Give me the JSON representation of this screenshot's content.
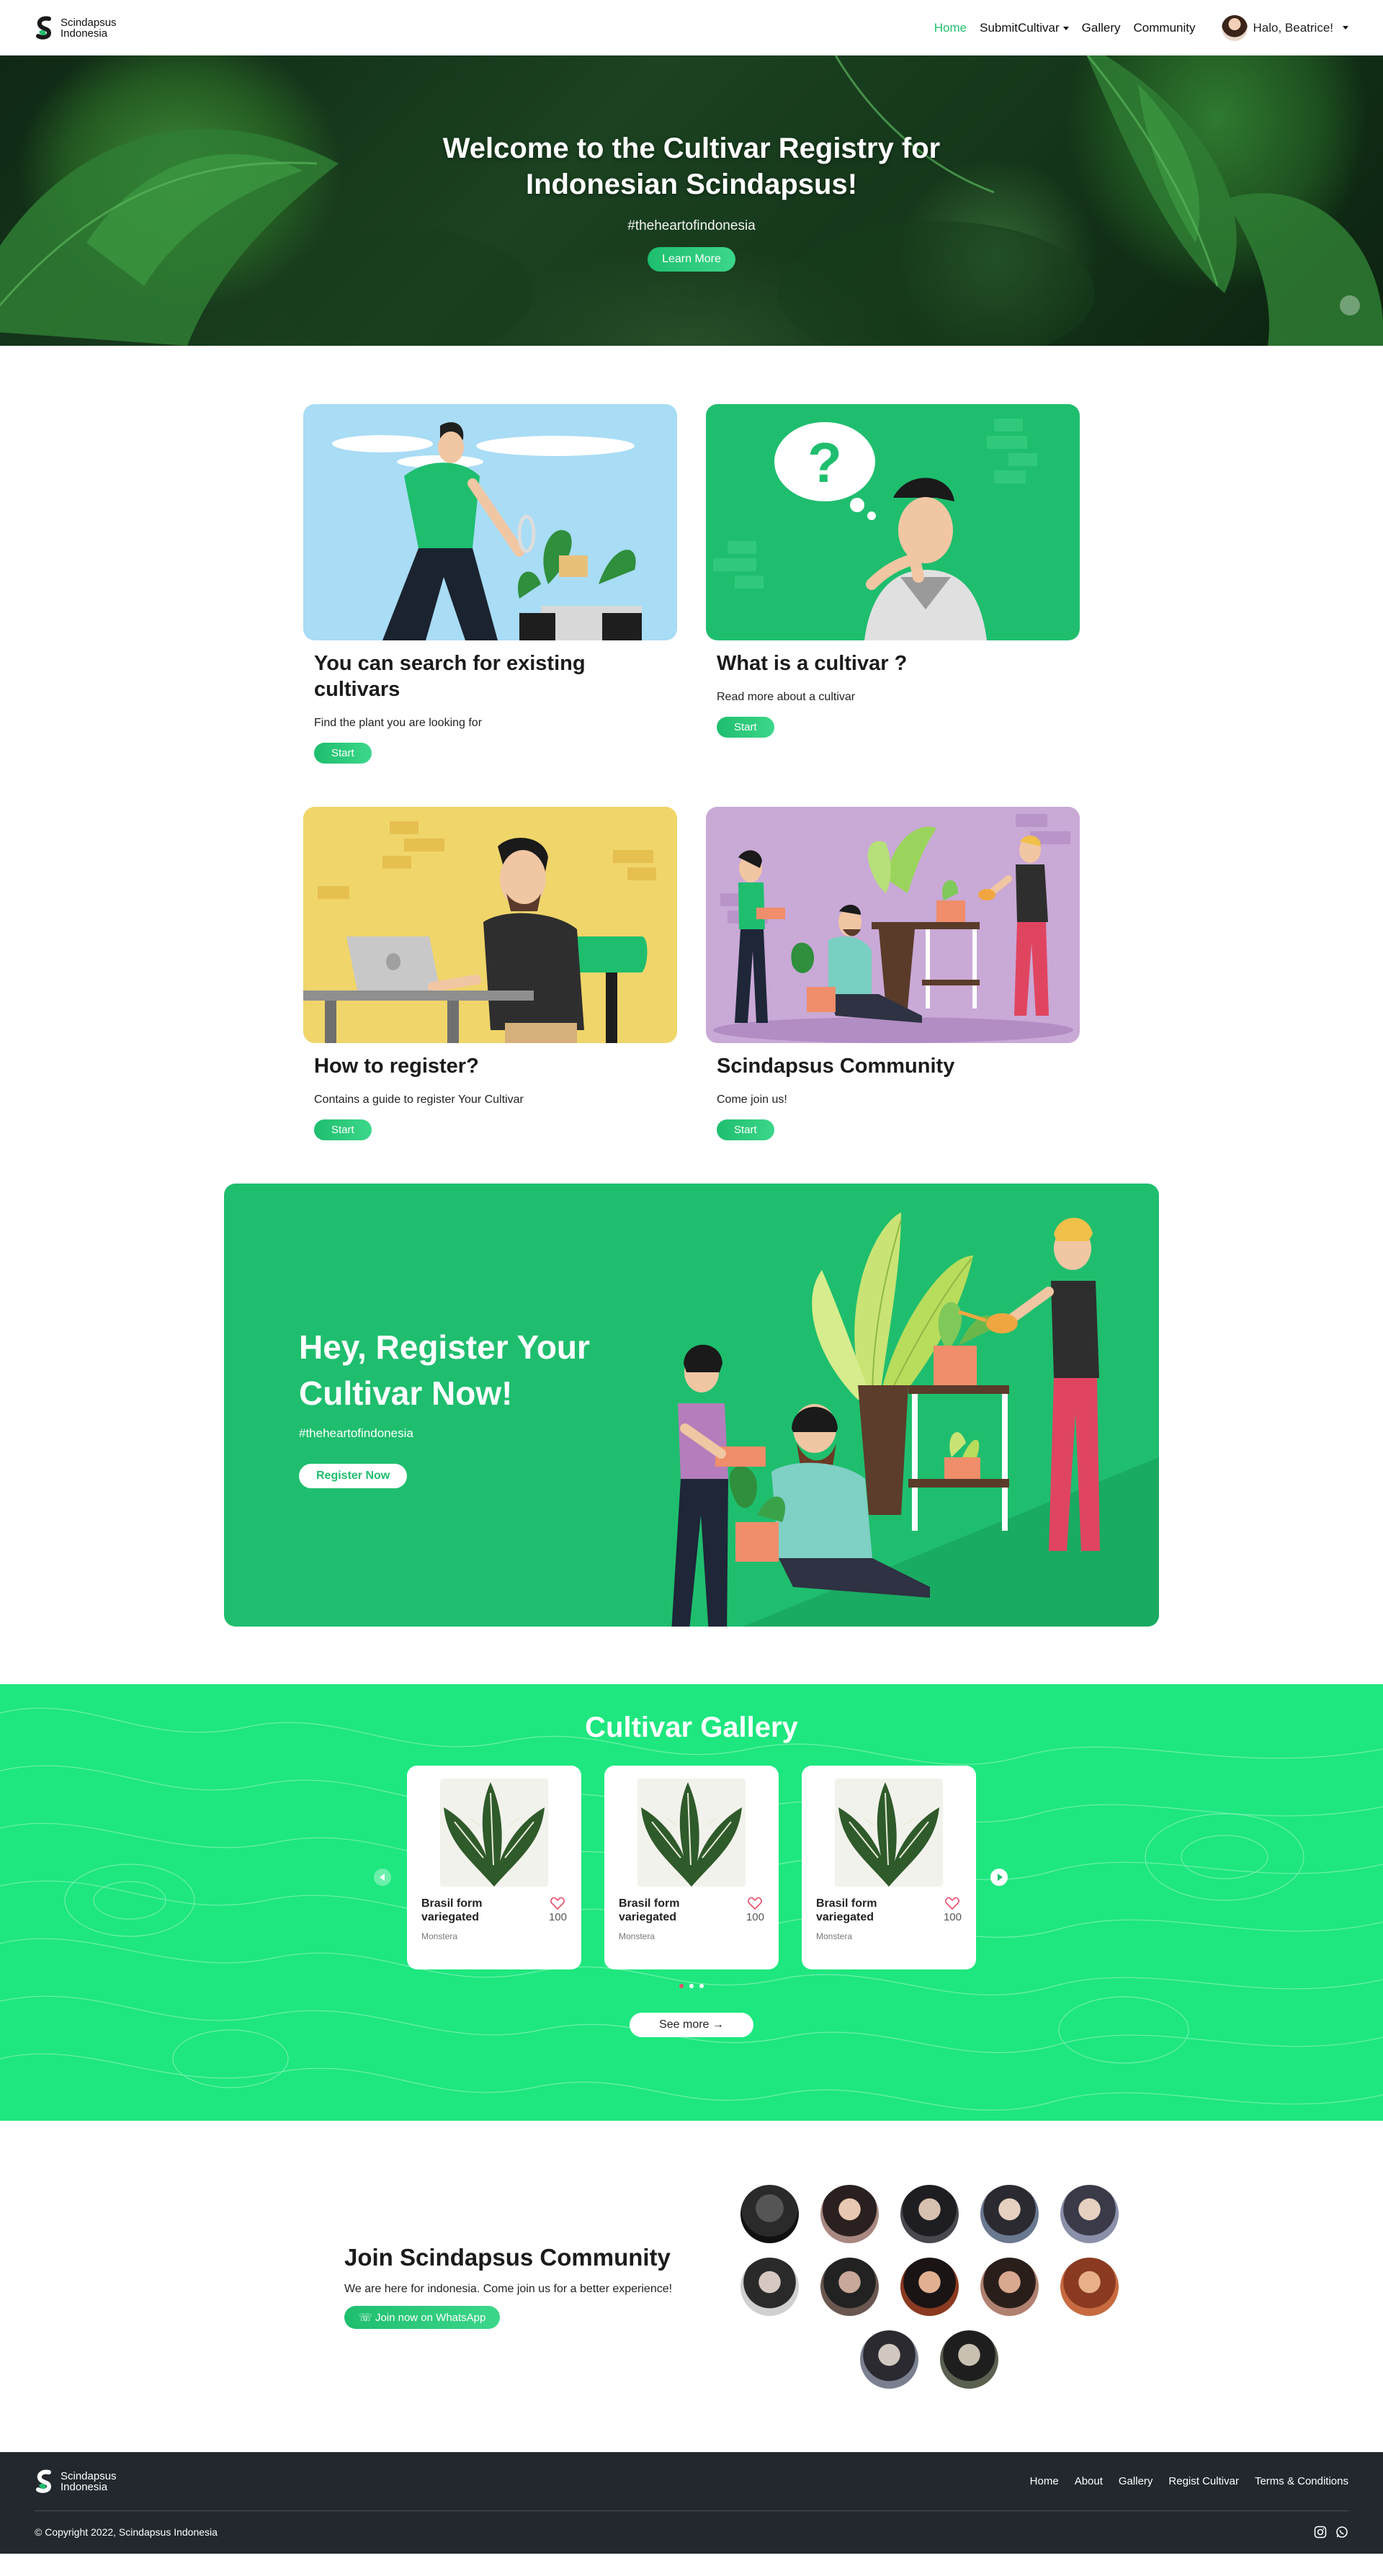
{
  "brand": {
    "line1": "Scindapsus",
    "line2": "Indonesia"
  },
  "nav": {
    "home": "Home",
    "submit": "SubmitCultivar",
    "gallery": "Gallery",
    "community": "Community",
    "user": "Halo, Beatrice!"
  },
  "hero": {
    "title": "Welcome to the Cultivar Registry for Indonesian Scindapsus!",
    "tag": "#theheartofindonesia",
    "cta": "Learn More"
  },
  "features": [
    {
      "title": "You can search for existing cultivars",
      "desc": "Find the plant you are looking for",
      "cta": "Start"
    },
    {
      "title": "What is a cultivar ?",
      "desc": "Read more about a cultivar",
      "cta": "Start"
    },
    {
      "title": "How to register?",
      "desc": "Contains a guide to register Your Cultivar",
      "cta": "Start"
    },
    {
      "title": "Scindapsus Community",
      "desc": "Come join us!",
      "cta": "Start"
    }
  ],
  "register": {
    "title": "Hey, Register Your Cultivar Now!",
    "tag": "#theheartofindonesia",
    "cta": "Register Now"
  },
  "gallery": {
    "title": "Cultivar Gallery",
    "cards": [
      {
        "name": "Brasil form variegated",
        "likes": "100",
        "genus": "Monstera"
      },
      {
        "name": "Brasil form variegated",
        "likes": "100",
        "genus": "Monstera"
      },
      {
        "name": "Brasil form variegated",
        "likes": "100",
        "genus": "Monstera"
      }
    ],
    "see_more": "See more"
  },
  "community": {
    "title": "Join Scindapsus Community",
    "desc": "We are here for indonesia. Come join us for a better experience!",
    "cta": "Join now on WhatsApp"
  },
  "footer": {
    "links": [
      "Home",
      "About",
      "Gallery",
      "Regist Cultivar",
      "Terms & Conditions"
    ],
    "copyright": "© Copyright 2022, Scindapsus Indonesia"
  },
  "colors": {
    "accent": "#1fbe6e",
    "gallery_bg": "#1ee77f",
    "footer_bg": "#22282e",
    "like": "#e74c6b"
  }
}
